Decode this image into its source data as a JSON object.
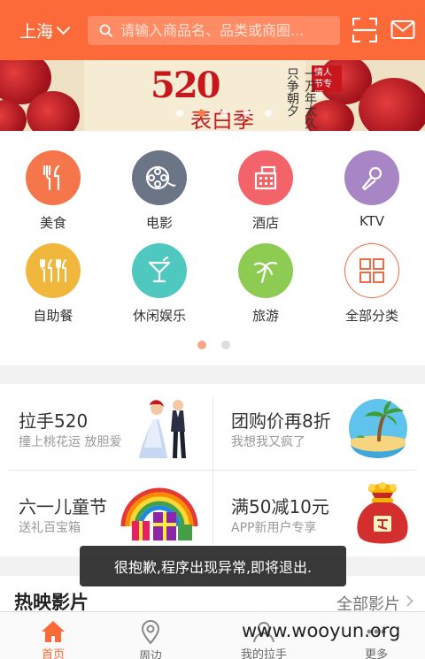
{
  "header": {
    "city": "上海",
    "search_placeholder": "请输入商品名、品类或商圈..."
  },
  "banner": {
    "headline": "520",
    "subtitle": "表白季",
    "tag": "情人节专题",
    "vertical_text": "一万年太久 只争朝夕",
    "slide_count": 5,
    "active_slide": 2
  },
  "categories": [
    {
      "label": "美食",
      "icon": "fork-knife-icon",
      "color": "#f5764b"
    },
    {
      "label": "电影",
      "icon": "film-reel-icon",
      "color": "#6b7586"
    },
    {
      "label": "酒店",
      "icon": "hotel-building-icon",
      "color": "#f2646a"
    },
    {
      "label": "KTV",
      "icon": "microphone-icon",
      "color": "#a886c6"
    },
    {
      "label": "自助餐",
      "icon": "buffet-utensils-icon",
      "color": "#f1b73c"
    },
    {
      "label": "休闲娱乐",
      "icon": "cocktail-icon",
      "color": "#4fc8c0"
    },
    {
      "label": "旅游",
      "icon": "palm-tree-icon",
      "color": "#8dcb52"
    },
    {
      "label": "全部分类",
      "icon": "grid-icon",
      "color": "#f06a45"
    }
  ],
  "category_pages": {
    "count": 2,
    "active": 0
  },
  "promos": [
    {
      "title": "拉手520",
      "subtitle": "撞上桃花运 放胆爱",
      "image": "couple-illustration"
    },
    {
      "title": "团购价再8折",
      "subtitle": "我想我又疯了",
      "image": "island-illustration"
    },
    {
      "title": "六一儿童节",
      "subtitle": "送礼百宝箱",
      "image": "rainbow-gift-illustration"
    },
    {
      "title": "满50减10元",
      "subtitle": "APP新用户专享",
      "image": "money-bag-illustration"
    }
  ],
  "hot_movies": {
    "title": "热映影片",
    "all_label": "全部影片"
  },
  "toast": "很抱歉,程序出现异常,即将退出.",
  "tabs": [
    {
      "label": "首页",
      "icon": "home-icon"
    },
    {
      "label": "周边",
      "icon": "location-pin-icon"
    },
    {
      "label": "我的拉手",
      "icon": "user-icon"
    },
    {
      "label": "更多",
      "icon": "more-icon"
    }
  ],
  "active_tab": 0,
  "watermark": "www.wooyun.org",
  "colors": {
    "accent": "#fd6a3a",
    "search_bg": "#fe8b64"
  }
}
